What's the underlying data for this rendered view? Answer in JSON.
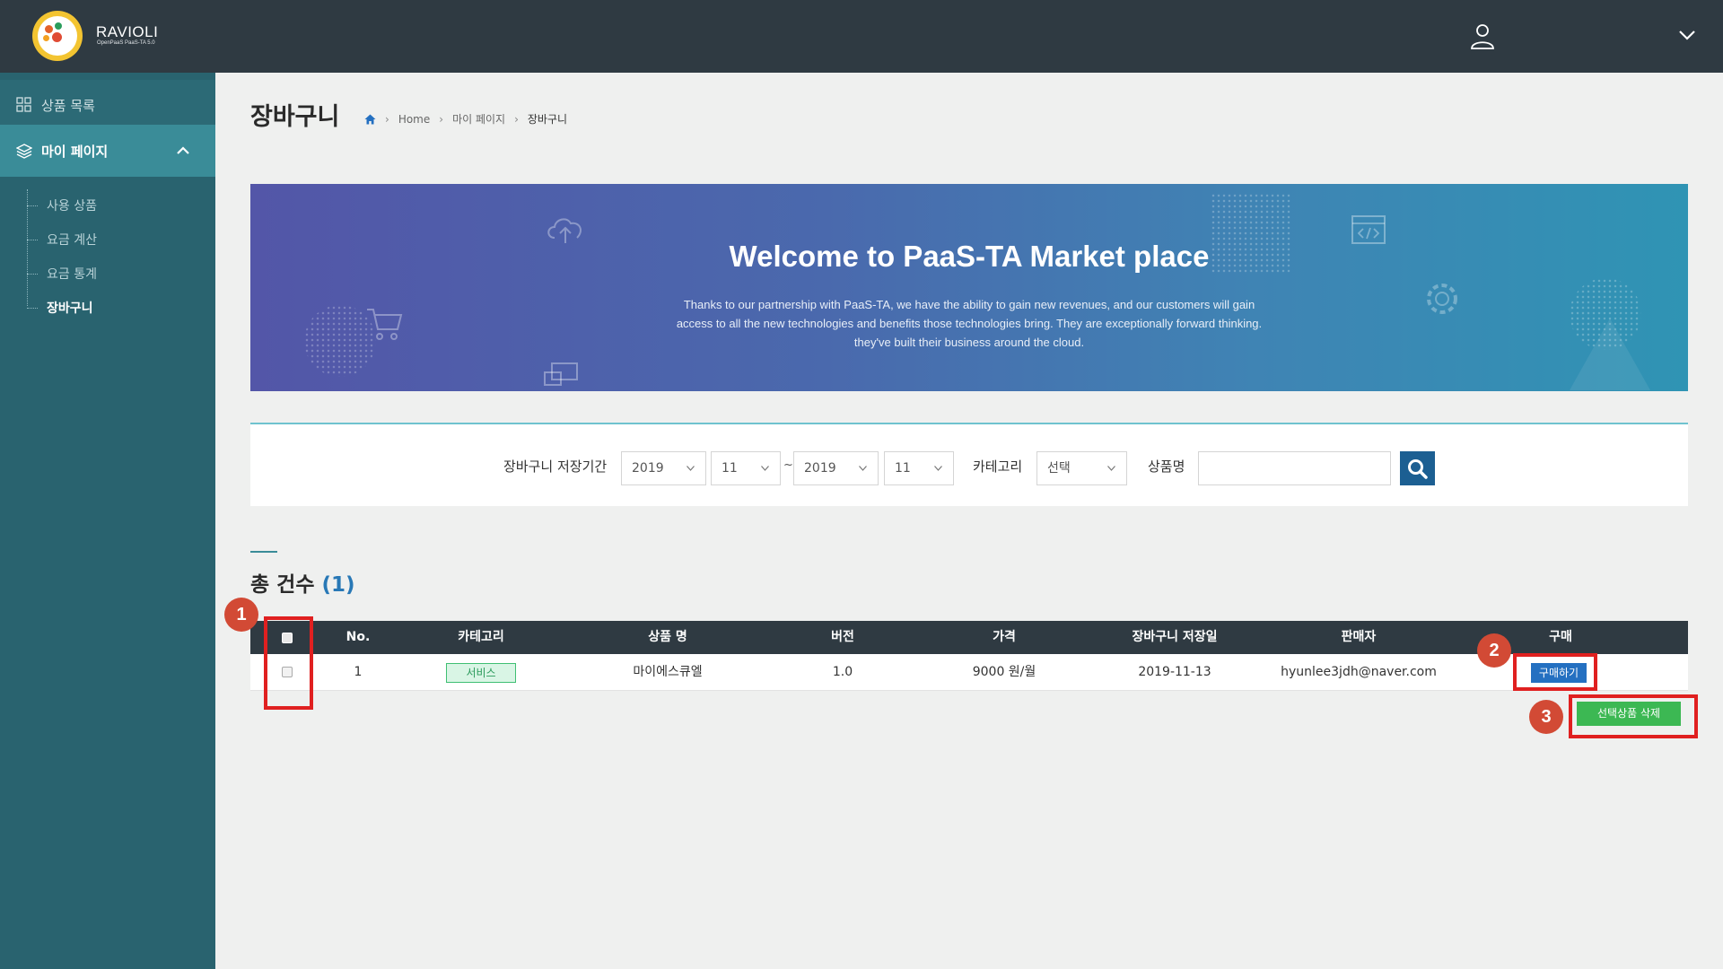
{
  "header": {
    "brand": "RAVIOLI",
    "brand_sub": "OpenPaaS PaaS-TA 5.0",
    "colors": {
      "bar": "#2f3a42",
      "logo": "#f3c431"
    },
    "icons": [
      "user-icon",
      "chevron-down-icon"
    ]
  },
  "sidebar": {
    "items": [
      {
        "label": "상품 목록",
        "icon": "grid-icon"
      },
      {
        "label": "마이 페이지",
        "icon": "layers-icon",
        "expanded": true
      }
    ],
    "sub_items": [
      {
        "label": "사용 상품"
      },
      {
        "label": "요금 계산"
      },
      {
        "label": "요금 통계"
      },
      {
        "label": "장바구니",
        "active": true
      }
    ],
    "colors": {
      "bg": "#29636f",
      "active": "#3a8c98"
    }
  },
  "page": {
    "title": "장바구니",
    "breadcrumb": [
      "Home",
      "마이 페이지",
      "장바구니"
    ]
  },
  "banner": {
    "title": "Welcome to PaaS-TA Market place",
    "text_lines": [
      "Thanks to our partnership with PaaS-TA, we have the ability to gain new revenues, and our customers will gain",
      "access to all the new technologies and benefits those technologies bring. They are exceptionally forward thinking.",
      "they've built their business around the cloud."
    ]
  },
  "search": {
    "period_label": "장바구니 저장기간",
    "from_year": "2019",
    "from_month": "11",
    "separator": "~",
    "to_year": "2019",
    "to_month": "11",
    "category_label": "카테고리",
    "category_value": "선택",
    "name_label": "상품명",
    "name_value": ""
  },
  "summary": {
    "label": "총 건수",
    "count": "(1)"
  },
  "table": {
    "columns": [
      "No.",
      "카테고리",
      "상품 명",
      "버전",
      "가격",
      "장바구니 저장일",
      "판매자",
      "구매"
    ],
    "rows": [
      {
        "no": "1",
        "category": "서비스",
        "name": "마이에스큐엘",
        "version": "1.0",
        "price": "9000 원/월",
        "saved": "2019-11-13",
        "seller": "hyunlee3jdh@naver.com",
        "buy": "구매하기"
      }
    ],
    "delete_button": "선택상품 삭제"
  },
  "annotations": {
    "markers": [
      "1",
      "2",
      "3"
    ],
    "color": "#e02020"
  }
}
